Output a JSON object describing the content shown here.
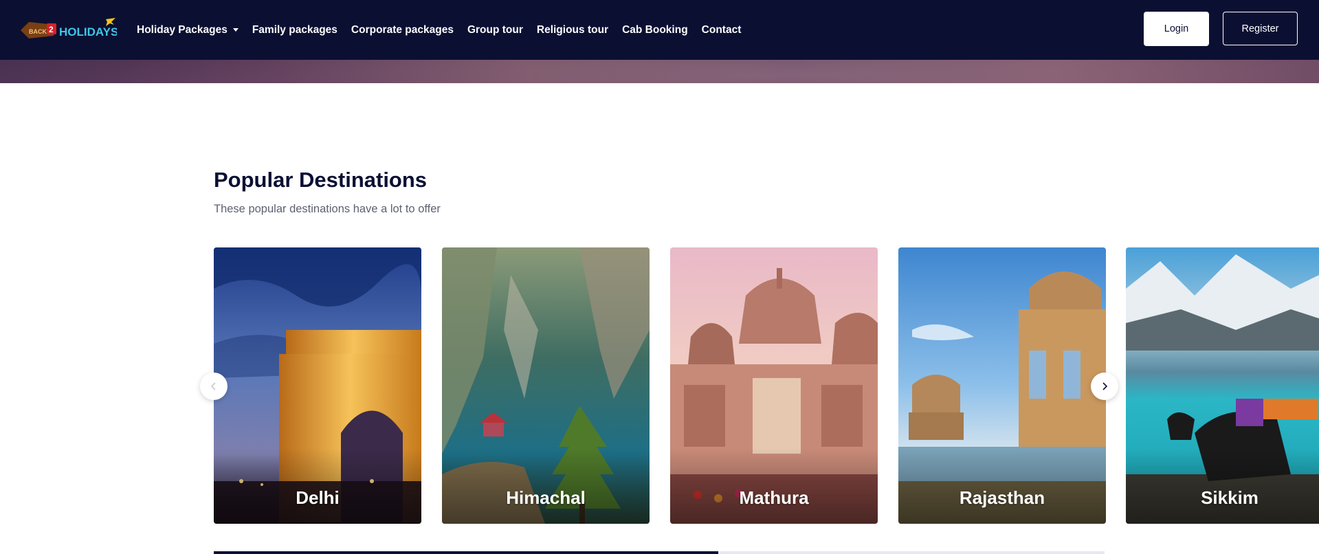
{
  "brand": {
    "logo_alt": "Back 2 Holidays",
    "logo_text_back": "BACK",
    "logo_text_2": "2",
    "logo_text_holidays": "HOLIDAYS"
  },
  "nav": {
    "items": [
      {
        "label": "Holiday Packages",
        "has_dropdown": true
      },
      {
        "label": "Family packages"
      },
      {
        "label": "Corporate packages"
      },
      {
        "label": "Group tour"
      },
      {
        "label": "Religious tour"
      },
      {
        "label": "Cab Booking"
      },
      {
        "label": "Contact"
      }
    ]
  },
  "auth": {
    "login_label": "Login",
    "register_label": "Register"
  },
  "section": {
    "title": "Popular Destinations",
    "subtitle": "These popular destinations have a lot to offer"
  },
  "carousel": {
    "cards": [
      {
        "label": "Delhi"
      },
      {
        "label": "Himachal"
      },
      {
        "label": "Mathura"
      },
      {
        "label": "Rajasthan"
      },
      {
        "label": "Sikkim"
      }
    ],
    "prev_icon": "chevron-left-icon",
    "next_icon": "chevron-right-icon",
    "progress_fraction": 0.566
  },
  "colors": {
    "navy": "#0b1033",
    "white": "#ffffff",
    "subtitle_gray": "#5c6270"
  }
}
